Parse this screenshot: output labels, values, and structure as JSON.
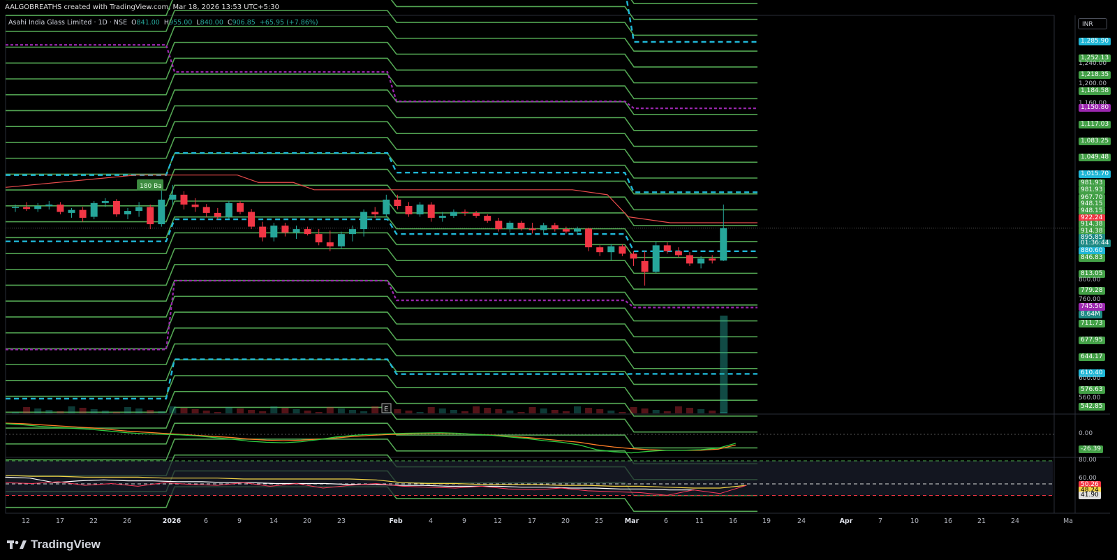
{
  "header": {
    "credit": "AALGOBREATHS created with TradingView.com, Mar 18, 2026 13:53 UTC+5:30",
    "legend_name": "Asahi India Glass Limited · 1D · NSE",
    "legend_o": "O",
    "legend_o_val": "841.00",
    "legend_h": "H",
    "legend_h_val": "955.00",
    "legend_l": "L",
    "legend_l_val": "840.00",
    "legend_c": "C",
    "legend_c_val": "906.85",
    "legend_chg": "+65.95 (+7.86%)"
  },
  "currency": "INR",
  "brand": "TradingView",
  "colors": {
    "background": "#000000",
    "up": "#26a69a",
    "down": "#f23645",
    "green_line": "#5cb85c",
    "cyan": "#1fb6d6",
    "purple": "#9c27b0",
    "red_line": "#e84b4b",
    "macd_orange": "#ff7f27",
    "macd_green": "#2ecc40",
    "rsi_red": "#ff3b5c",
    "rsi_yellow": "#f5d547",
    "rsi_white": "#ffffff"
  },
  "chart_data": {
    "type": "candlestick",
    "symbol": "Asahi India Glass Limited",
    "interval": "1D",
    "exchange": "NSE",
    "ylim": [
      530,
      1340
    ],
    "x_ticks": [
      "12",
      "17",
      "22",
      "26",
      "2026",
      "6",
      "9",
      "14",
      "20",
      "23",
      "Feb",
      "4",
      "9",
      "12",
      "17",
      "20",
      "25",
      "Mar",
      "6",
      "11",
      "16",
      "19",
      "24",
      "Apr",
      "7",
      "10",
      "16",
      "21",
      "24",
      "Ma"
    ],
    "candles": [
      {
        "o": 948,
        "h": 955,
        "l": 940,
        "c": 950
      },
      {
        "o": 950,
        "h": 960,
        "l": 942,
        "c": 946
      },
      {
        "o": 946,
        "h": 958,
        "l": 940,
        "c": 952
      },
      {
        "o": 952,
        "h": 962,
        "l": 945,
        "c": 955
      },
      {
        "o": 955,
        "h": 960,
        "l": 935,
        "c": 940
      },
      {
        "o": 938,
        "h": 948,
        "l": 928,
        "c": 944
      },
      {
        "o": 944,
        "h": 950,
        "l": 920,
        "c": 928
      },
      {
        "o": 930,
        "h": 962,
        "l": 925,
        "c": 958
      },
      {
        "o": 958,
        "h": 968,
        "l": 950,
        "c": 962
      },
      {
        "o": 962,
        "h": 966,
        "l": 930,
        "c": 935
      },
      {
        "o": 935,
        "h": 948,
        "l": 925,
        "c": 942
      },
      {
        "o": 942,
        "h": 960,
        "l": 930,
        "c": 950
      },
      {
        "o": 950,
        "h": 955,
        "l": 905,
        "c": 915
      },
      {
        "o": 915,
        "h": 990,
        "l": 910,
        "c": 965
      },
      {
        "o": 965,
        "h": 995,
        "l": 955,
        "c": 975
      },
      {
        "o": 975,
        "h": 982,
        "l": 945,
        "c": 955
      },
      {
        "o": 955,
        "h": 968,
        "l": 940,
        "c": 950
      },
      {
        "o": 950,
        "h": 956,
        "l": 930,
        "c": 938
      },
      {
        "o": 938,
        "h": 948,
        "l": 925,
        "c": 930
      },
      {
        "o": 930,
        "h": 962,
        "l": 925,
        "c": 958
      },
      {
        "o": 958,
        "h": 962,
        "l": 935,
        "c": 940
      },
      {
        "o": 940,
        "h": 946,
        "l": 905,
        "c": 910
      },
      {
        "o": 910,
        "h": 920,
        "l": 880,
        "c": 888
      },
      {
        "o": 888,
        "h": 918,
        "l": 880,
        "c": 912
      },
      {
        "o": 912,
        "h": 918,
        "l": 890,
        "c": 898
      },
      {
        "o": 898,
        "h": 912,
        "l": 885,
        "c": 905
      },
      {
        "o": 905,
        "h": 910,
        "l": 892,
        "c": 895
      },
      {
        "o": 895,
        "h": 905,
        "l": 872,
        "c": 878
      },
      {
        "o": 878,
        "h": 902,
        "l": 860,
        "c": 870
      },
      {
        "o": 870,
        "h": 900,
        "l": 865,
        "c": 895
      },
      {
        "o": 895,
        "h": 912,
        "l": 880,
        "c": 905
      },
      {
        "o": 905,
        "h": 945,
        "l": 890,
        "c": 940
      },
      {
        "o": 940,
        "h": 950,
        "l": 928,
        "c": 935
      },
      {
        "o": 935,
        "h": 975,
        "l": 930,
        "c": 965
      },
      {
        "o": 965,
        "h": 975,
        "l": 945,
        "c": 952
      },
      {
        "o": 952,
        "h": 960,
        "l": 930,
        "c": 935
      },
      {
        "o": 935,
        "h": 960,
        "l": 930,
        "c": 955
      },
      {
        "o": 955,
        "h": 960,
        "l": 920,
        "c": 928
      },
      {
        "o": 928,
        "h": 940,
        "l": 920,
        "c": 932
      },
      {
        "o": 932,
        "h": 945,
        "l": 928,
        "c": 940
      },
      {
        "o": 940,
        "h": 945,
        "l": 932,
        "c": 938
      },
      {
        "o": 938,
        "h": 942,
        "l": 928,
        "c": 932
      },
      {
        "o": 932,
        "h": 935,
        "l": 918,
        "c": 922
      },
      {
        "o": 922,
        "h": 928,
        "l": 900,
        "c": 905
      },
      {
        "o": 905,
        "h": 922,
        "l": 898,
        "c": 918
      },
      {
        "o": 918,
        "h": 922,
        "l": 902,
        "c": 906
      },
      {
        "o": 906,
        "h": 918,
        "l": 896,
        "c": 903
      },
      {
        "o": 903,
        "h": 918,
        "l": 896,
        "c": 913
      },
      {
        "o": 913,
        "h": 918,
        "l": 900,
        "c": 905
      },
      {
        "o": 905,
        "h": 910,
        "l": 896,
        "c": 900
      },
      {
        "o": 900,
        "h": 910,
        "l": 895,
        "c": 906
      },
      {
        "o": 906,
        "h": 908,
        "l": 860,
        "c": 868
      },
      {
        "o": 868,
        "h": 872,
        "l": 850,
        "c": 858
      },
      {
        "o": 858,
        "h": 875,
        "l": 842,
        "c": 870
      },
      {
        "o": 870,
        "h": 874,
        "l": 850,
        "c": 855
      },
      {
        "o": 855,
        "h": 860,
        "l": 830,
        "c": 845
      },
      {
        "o": 840,
        "h": 860,
        "l": 790,
        "c": 818
      },
      {
        "o": 818,
        "h": 880,
        "l": 815,
        "c": 872
      },
      {
        "o": 872,
        "h": 878,
        "l": 855,
        "c": 860
      },
      {
        "o": 860,
        "h": 868,
        "l": 848,
        "c": 852
      },
      {
        "o": 852,
        "h": 858,
        "l": 830,
        "c": 835
      },
      {
        "o": 835,
        "h": 850,
        "l": 825,
        "c": 845
      },
      {
        "o": 845,
        "h": 852,
        "l": 835,
        "c": 841
      },
      {
        "o": 841,
        "h": 955,
        "l": 840,
        "c": 906.85
      }
    ],
    "price_labels": [
      {
        "text": "1,285.90",
        "value": 1285.9,
        "kind": "cyan"
      },
      {
        "text": "1,252.13",
        "value": 1252.13,
        "kind": "green"
      },
      {
        "text": "1,240.00",
        "value": 1240,
        "kind": "scale"
      },
      {
        "text": "1,218.35",
        "value": 1218.35,
        "kind": "green"
      },
      {
        "text": "1,200.00",
        "value": 1200,
        "kind": "scale"
      },
      {
        "text": "1,184.58",
        "value": 1184.58,
        "kind": "green"
      },
      {
        "text": "1,160.00",
        "value": 1160,
        "kind": "scale"
      },
      {
        "text": "1,150.80",
        "value": 1150.8,
        "kind": "purple"
      },
      {
        "text": "1,117.03",
        "value": 1117.03,
        "kind": "green"
      },
      {
        "text": "1,083.25",
        "value": 1083.25,
        "kind": "green"
      },
      {
        "text": "1,049.48",
        "value": 1049.48,
        "kind": "green"
      },
      {
        "text": "1,015.70",
        "value": 1015.7,
        "kind": "cyan"
      },
      {
        "text": "981.93",
        "value": 997,
        "kind": "green"
      },
      {
        "text": "981.93",
        "value": 983,
        "kind": "green"
      },
      {
        "text": "967.70",
        "value": 968,
        "kind": "green"
      },
      {
        "text": "948.15",
        "value": 955,
        "kind": "green"
      },
      {
        "text": "948.15",
        "value": 941,
        "kind": "green"
      },
      {
        "text": "922.24",
        "value": 927,
        "kind": "red"
      },
      {
        "text": "914.38",
        "value": 914,
        "kind": "green"
      },
      {
        "text": "914.38",
        "value": 900,
        "kind": "green"
      },
      {
        "text": "895.85",
        "value": 886,
        "kind": "teal"
      },
      {
        "text": "01:36:44",
        "value": 875,
        "kind": "teal"
      },
      {
        "text": "880.60",
        "value": 860,
        "kind": "cyan"
      },
      {
        "text": "846.83",
        "value": 846,
        "kind": "green"
      },
      {
        "text": "813.05",
        "value": 813,
        "kind": "green"
      },
      {
        "text": "800.00",
        "value": 800,
        "kind": "scale"
      },
      {
        "text": "779.28",
        "value": 779,
        "kind": "green"
      },
      {
        "text": "760.00",
        "value": 760,
        "kind": "scale"
      },
      {
        "text": "745.50",
        "value": 745.5,
        "kind": "purple"
      },
      {
        "text": "8.64M",
        "value": 731,
        "kind": "teal"
      },
      {
        "text": "711.73",
        "value": 711.7,
        "kind": "green"
      },
      {
        "text": "677.95",
        "value": 678,
        "kind": "green"
      },
      {
        "text": "644.17",
        "value": 644,
        "kind": "green"
      },
      {
        "text": "610.40",
        "value": 610.4,
        "kind": "cyan"
      },
      {
        "text": "600.00",
        "value": 600,
        "kind": "scale"
      },
      {
        "text": "576.63",
        "value": 576.6,
        "kind": "green"
      },
      {
        "text": "560.00",
        "value": 560,
        "kind": "scale"
      },
      {
        "text": "542.85",
        "value": 542.9,
        "kind": "green"
      }
    ],
    "badge_label": "180 Ba",
    "event_marker": "E",
    "macd_labels": [
      {
        "text": "0.00",
        "kind": "scale"
      },
      {
        "text": "-26.39",
        "kind": "green"
      }
    ],
    "rsi_labels": [
      {
        "text": "80.00",
        "value": 80,
        "kind": "scale"
      },
      {
        "text": "60.00",
        "value": 60,
        "kind": "scale"
      },
      {
        "text": "50.26",
        "value": 53,
        "kind": "red"
      },
      {
        "text": "48.24",
        "value": 47,
        "kind": "yellow"
      },
      {
        "text": "41.90",
        "value": 41.9,
        "kind": "white"
      }
    ],
    "rsi_ylim": [
      30,
      90
    ]
  }
}
